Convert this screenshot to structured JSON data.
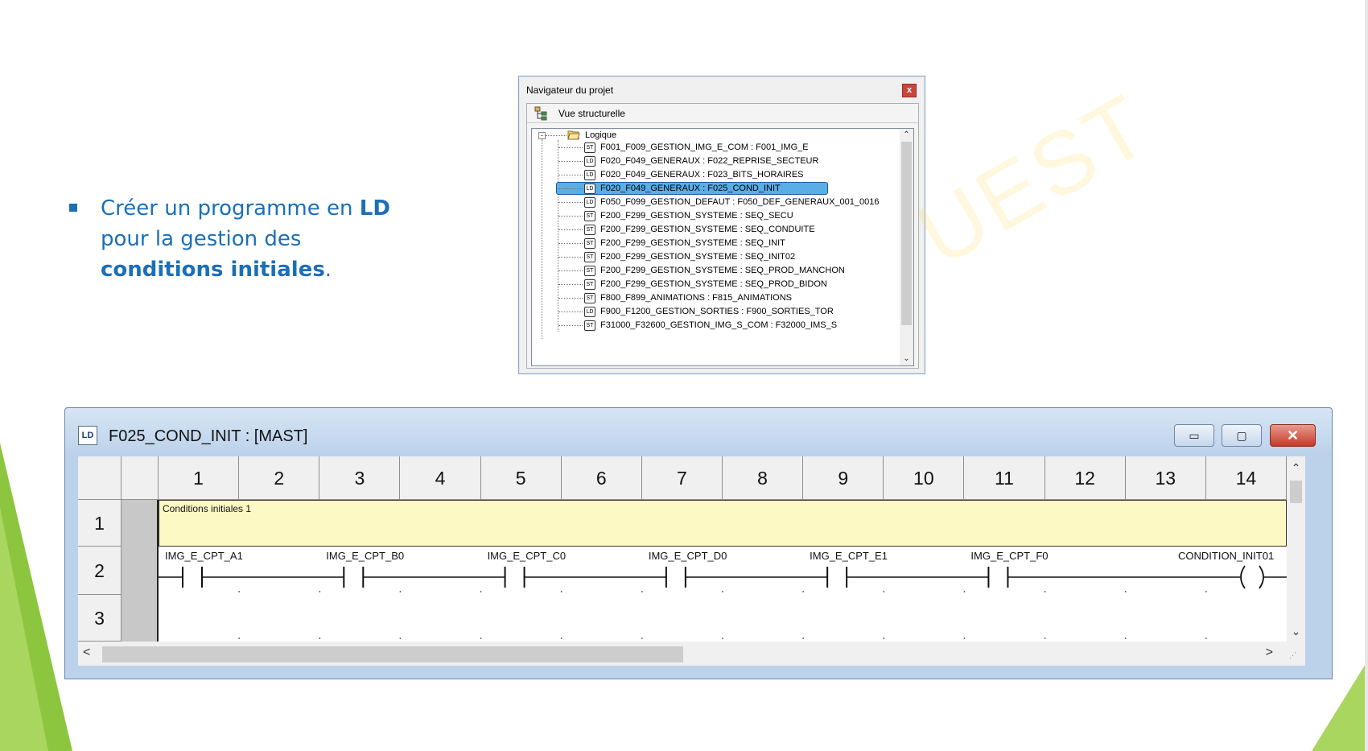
{
  "bullet": {
    "part1": "Créer un programme en ",
    "bold1": "LD",
    "part2": " pour la gestion des ",
    "bold2": "conditions initiales",
    "part3": "."
  },
  "navigator": {
    "title": "Navigateur du projet",
    "close_label": "x",
    "tab_label": "Vue structurelle",
    "root_label": "Logique",
    "items": [
      {
        "type": "ST",
        "name": "F001_F009_GESTION_IMG_E_COM : F001_IMG_E"
      },
      {
        "type": "LD",
        "name": "F020_F049_GENERAUX : F022_REPRISE_SECTEUR"
      },
      {
        "type": "LD",
        "name": "F020_F049_GENERAUX : F023_BITS_HORAIRES"
      },
      {
        "type": "LD",
        "name": "F020_F049_GENERAUX : F025_COND_INIT",
        "selected": true
      },
      {
        "type": "LD",
        "name": "F050_F099_GESTION_DEFAUT : F050_DEF_GENERAUX_001_0016"
      },
      {
        "type": "ST",
        "name": "F200_F299_GESTION_SYSTEME : SEQ_SECU"
      },
      {
        "type": "ST",
        "name": "F200_F299_GESTION_SYSTEME : SEQ_CONDUITE"
      },
      {
        "type": "ST",
        "name": "F200_F299_GESTION_SYSTEME : SEQ_INIT"
      },
      {
        "type": "ST",
        "name": "F200_F299_GESTION_SYSTEME : SEQ_INIT02"
      },
      {
        "type": "ST",
        "name": "F200_F299_GESTION_SYSTEME : SEQ_PROD_MANCHON"
      },
      {
        "type": "ST",
        "name": "F200_F299_GESTION_SYSTEME : SEQ_PROD_BIDON"
      },
      {
        "type": "ST",
        "name": "F800_F899_ANIMATIONS : F815_ANIMATIONS"
      },
      {
        "type": "LD",
        "name": "F900_F1200_GESTION_SORTIES : F900_SORTIES_TOR"
      },
      {
        "type": "ST",
        "name": "F31000_F32600_GESTION_IMG_S_COM : F32000_IMS_S"
      }
    ]
  },
  "editor": {
    "icon_label": "LD",
    "title": "F025_COND_INIT : [MAST]",
    "min_label": "▭",
    "max_label": "▢",
    "close_label": "✕",
    "columns": [
      "1",
      "2",
      "3",
      "4",
      "5",
      "6",
      "7",
      "8",
      "9",
      "10",
      "11",
      "12",
      "13",
      "14"
    ],
    "rows": [
      "1",
      "2",
      "3"
    ],
    "comment": "Conditions initiales 1",
    "contacts": [
      "IMG_E_CPT_A1",
      "IMG_E_CPT_B0",
      "IMG_E_CPT_C0",
      "IMG_E_CPT_D0",
      "IMG_E_CPT_E1",
      "IMG_E_CPT_F0"
    ],
    "coil": "CONDITION_INIT01"
  },
  "colors": {
    "accent_text": "#1b6fb7",
    "selection": "#5aaee6",
    "comment_bg": "#fdf9c4",
    "slide_green": "#8cc63f"
  }
}
